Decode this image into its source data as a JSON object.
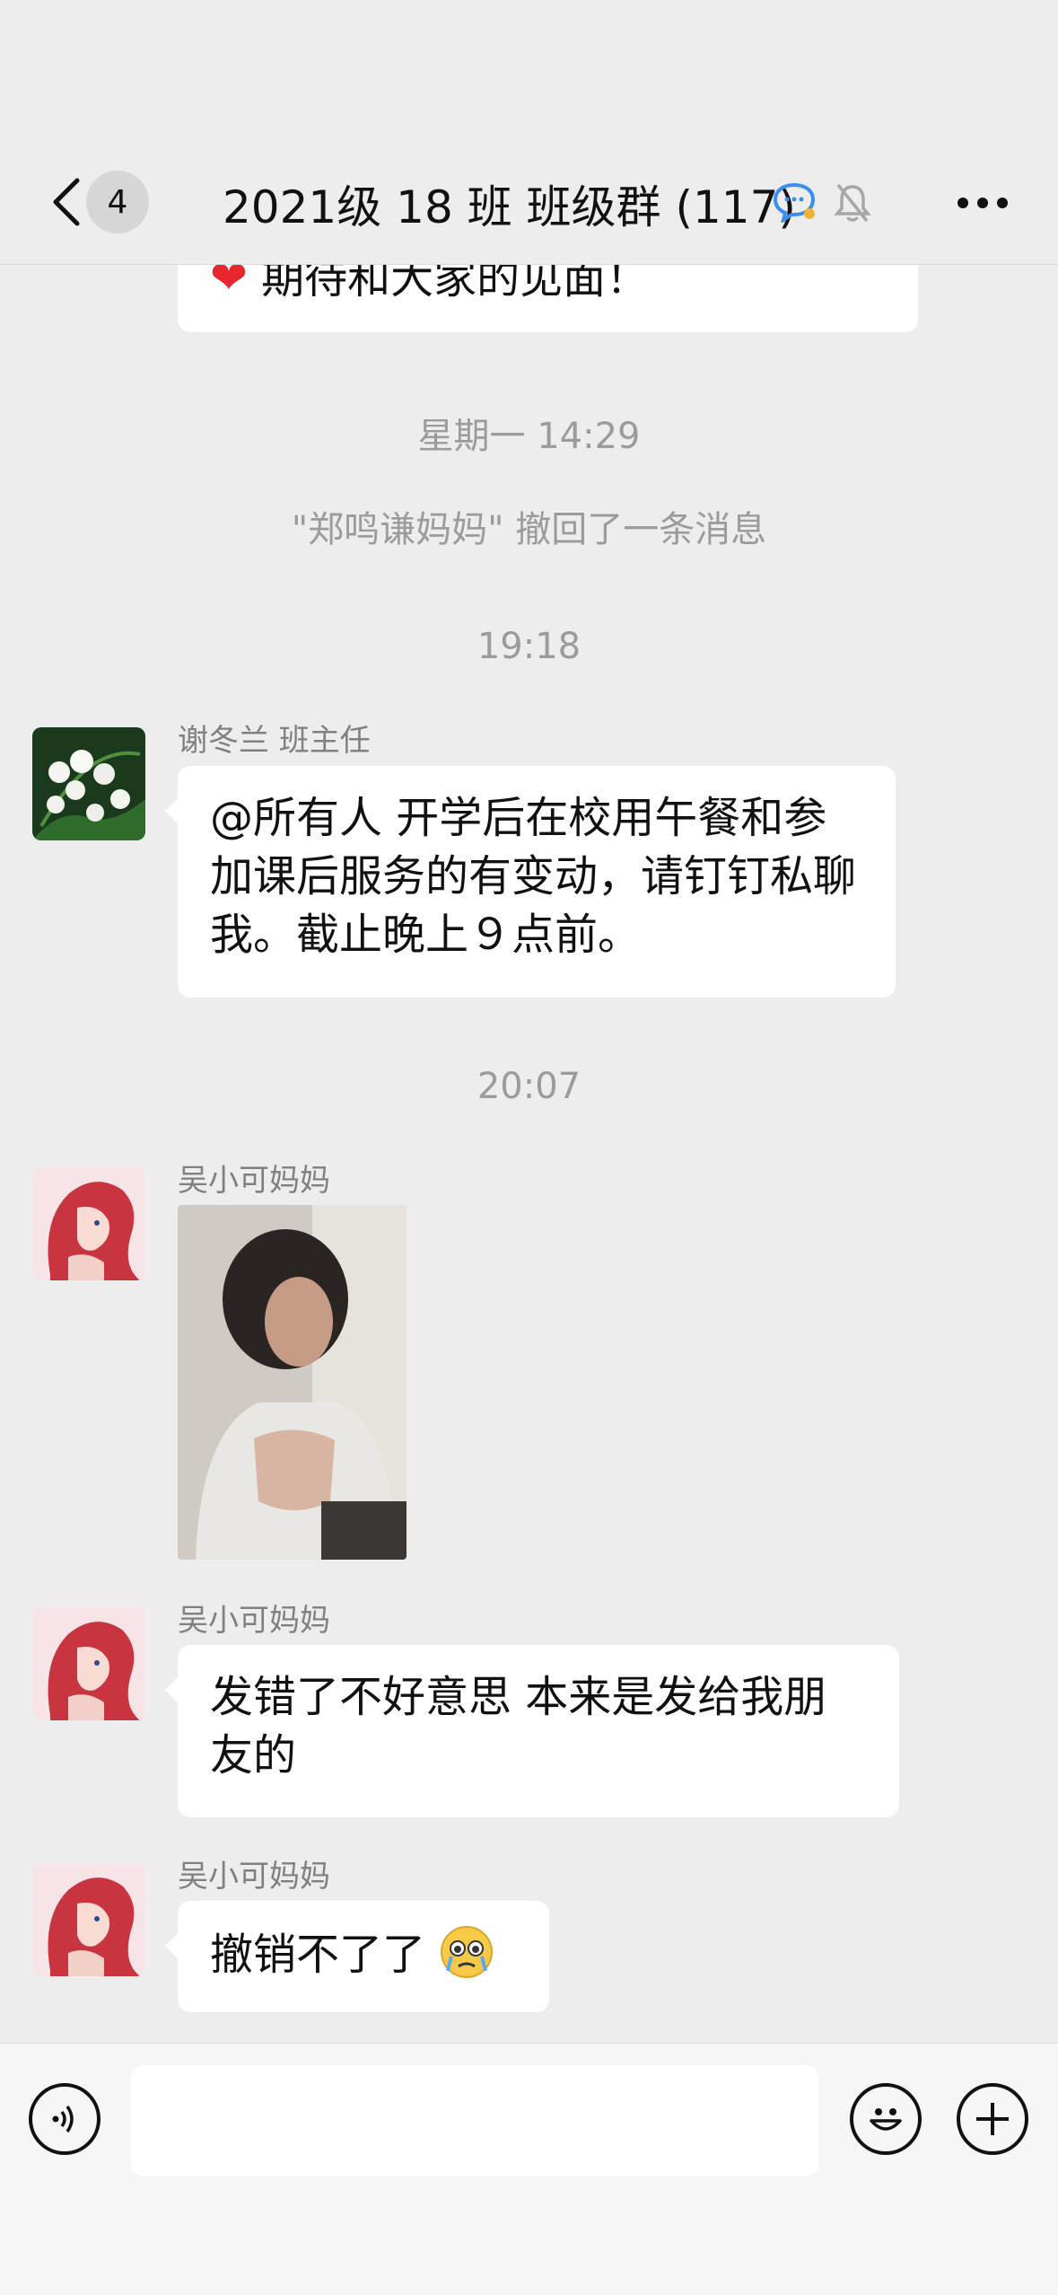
{
  "header": {
    "unread_count": "4",
    "title": "2021级 18 班 班级群 (117)",
    "icons": [
      "back-chevron-icon",
      "chat-bubble-icon",
      "muted-bell-icon",
      "more-dots-icon"
    ]
  },
  "messages": {
    "partial_bubble_text": "期待和大家的见面！",
    "time_1": "星期一 14:29",
    "recall_notice": "\"郑鸣谦妈妈\" 撤回了一条消息",
    "time_2": "19:18",
    "msg1_sender": "谢冬兰 班主任",
    "msg1_text": "@所有人 开学后在校用午餐和参加课后服务的有变动，请钉钉私聊我。截止晚上９点前。",
    "time_3": "20:07",
    "msg2_sender": "吴小可妈妈",
    "msg3_sender": "吴小可妈妈",
    "msg3_text": "发错了不好意思 本来是发给我朋友的",
    "msg4_sender": "吴小可妈妈",
    "msg4_text": "撤销不了了"
  },
  "input": {
    "value": "",
    "icons": [
      "voice-icon",
      "emoji-icon",
      "plus-icon"
    ]
  },
  "colors": {
    "background": "#ededed",
    "bubble": "#ffffff",
    "timestamp": "#9b9b9b",
    "heart": "#e8262e"
  }
}
